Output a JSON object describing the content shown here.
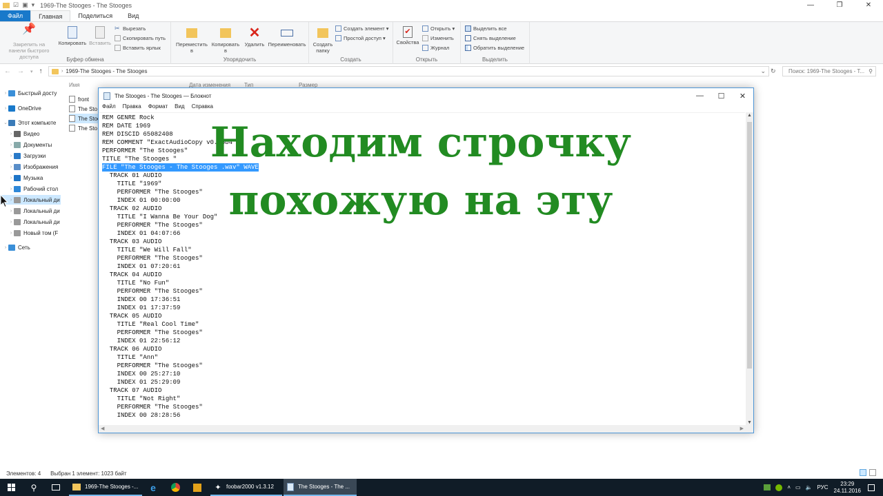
{
  "explorer": {
    "window_title": "1969-The Stooges - The Stooges",
    "tabs": [
      "Файл",
      "Главная",
      "Поделиться",
      "Вид"
    ],
    "ribbon": {
      "pin": "Закрепить на панели быстрого доступа",
      "copy": "Копировать",
      "paste": "Вставить",
      "cut": "Вырезать",
      "copy_path": "Скопировать путь",
      "paste_shortcut": "Вставить ярлык",
      "group_clipboard": "Буфер обмена",
      "move_to": "Переместить в",
      "copy_to": "Копировать в",
      "delete": "Удалить",
      "rename": "Переименовать",
      "group_organize": "Упорядочить",
      "new_folder": "Создать папку",
      "new_item": "Создать элемент",
      "easy_access": "Простой доступ",
      "group_create": "Создать",
      "properties": "Свойства",
      "open": "Открыть",
      "edit": "Изменить",
      "history": "Журнал",
      "group_open": "Открыть",
      "select_all": "Выделить все",
      "select_none": "Снять выделение",
      "invert_selection": "Обратить выделение",
      "group_select": "Выделить"
    },
    "address": "1969-The Stooges - The Stooges",
    "search_placeholder": "Поиск: 1969-The Stooges - T...",
    "sidebar": [
      {
        "label": "Быстрый досту",
        "icon": "star-icon"
      },
      {
        "label": "OneDrive",
        "icon": "cloud-icon"
      },
      {
        "label": "Этот компьюте",
        "icon": "computer-icon"
      },
      {
        "label": "Видео",
        "icon": "video-icon"
      },
      {
        "label": "Документы",
        "icon": "documents-icon"
      },
      {
        "label": "Загрузки",
        "icon": "download-icon"
      },
      {
        "label": "Изображения",
        "icon": "pictures-icon"
      },
      {
        "label": "Музыка",
        "icon": "music-icon"
      },
      {
        "label": "Рабочий стол",
        "icon": "desktop-icon"
      },
      {
        "label": "Локальный ди",
        "icon": "drive-icon"
      },
      {
        "label": "Локальный ди",
        "icon": "drive-icon"
      },
      {
        "label": "Локальный ди",
        "icon": "drive-icon"
      },
      {
        "label": "Новый том (F",
        "icon": "drive-icon"
      },
      {
        "label": "Сеть",
        "icon": "network-icon"
      }
    ],
    "columns": [
      "Имя",
      "Дата изменения",
      "Тип",
      "Размер"
    ],
    "files": [
      "front",
      "The Sto",
      "The Stoo",
      "The Sto"
    ],
    "status_count": "Элементов: 4",
    "status_selection": "Выбран 1 элемент: 1023 байт"
  },
  "notepad": {
    "title": "The Stooges - The Stooges — Блокнот",
    "menu": [
      "Файл",
      "Правка",
      "Формат",
      "Вид",
      "Справка"
    ],
    "highlighted_line": 6,
    "lines": [
      "REM GENRE Rock",
      "REM DATE 1969",
      "REM DISCID 65082408",
      "REM COMMENT \"ExactAudioCopy v0.95b4\"",
      "PERFORMER \"The Stooges\"",
      "TITLE \"The Stooges \"",
      "FILE \"The Stooges - The Stooges .wav\" WAVE",
      "  TRACK 01 AUDIO",
      "    TITLE \"1969\"",
      "    PERFORMER \"The Stooges\"",
      "    INDEX 01 00:00:00",
      "  TRACK 02 AUDIO",
      "    TITLE \"I Wanna Be Your Dog\"",
      "    PERFORMER \"The Stooges\"",
      "    INDEX 01 04:07:66",
      "  TRACK 03 AUDIO",
      "    TITLE \"We Will Fall\"",
      "    PERFORMER \"The Stooges\"",
      "    INDEX 01 07:20:61",
      "  TRACK 04 AUDIO",
      "    TITLE \"No Fun\"",
      "    PERFORMER \"The Stooges\"",
      "    INDEX 00 17:36:51",
      "    INDEX 01 17:37:59",
      "  TRACK 05 AUDIO",
      "    TITLE \"Real Cool Time\"",
      "    PERFORMER \"The Stooges\"",
      "    INDEX 01 22:56:12",
      "  TRACK 06 AUDIO",
      "    TITLE \"Ann\"",
      "    PERFORMER \"The Stooges\"",
      "    INDEX 00 25:27:10",
      "    INDEX 01 25:29:09",
      "  TRACK 07 AUDIO",
      "    TITLE \"Not Right\"",
      "    PERFORMER \"The Stooges\"",
      "    INDEX 00 28:28:56"
    ]
  },
  "overlay": {
    "line1": "Находим строчку",
    "line2": "похожую на эту",
    "color": "#228b22"
  },
  "taskbar": {
    "apps": [
      {
        "label": "1969-The Stooges -...",
        "icon": "folder-icon"
      },
      {
        "label": "foobar2000 v1.3.12",
        "icon": "foobar-icon"
      },
      {
        "label": "The Stooges - The ...",
        "icon": "notepad-icon"
      }
    ],
    "language": "РУС",
    "time": "23:29",
    "date": "24.11.2016"
  }
}
